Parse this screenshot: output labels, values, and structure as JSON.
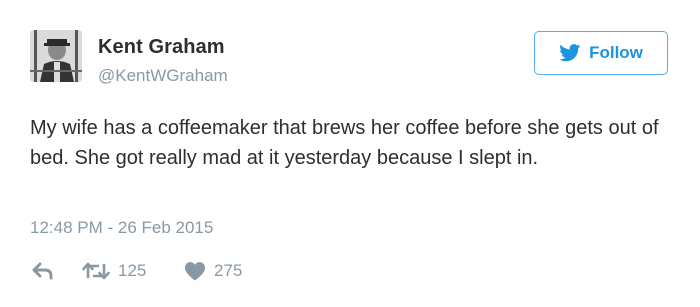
{
  "tweet": {
    "author": {
      "display_name": "Kent Graham",
      "handle": "@KentWGraham",
      "avatar_icon": "profile-photo"
    },
    "follow": {
      "label": "Follow",
      "icon": "twitter-bird-icon",
      "color": "#1b95e0"
    },
    "text": "My wife has a coffeemaker that brews her coffee before she gets out of bed. She got really mad at it yesterday because I slept in.",
    "timestamp": "12:48 PM - 26 Feb 2015",
    "actions": {
      "reply_icon": "reply-icon",
      "retweet_icon": "retweet-icon",
      "retweet_count": "125",
      "like_icon": "heart-icon",
      "like_count": "275"
    },
    "colors": {
      "text": "#292f33",
      "muted": "#8899a6",
      "accent": "#55acee"
    }
  }
}
